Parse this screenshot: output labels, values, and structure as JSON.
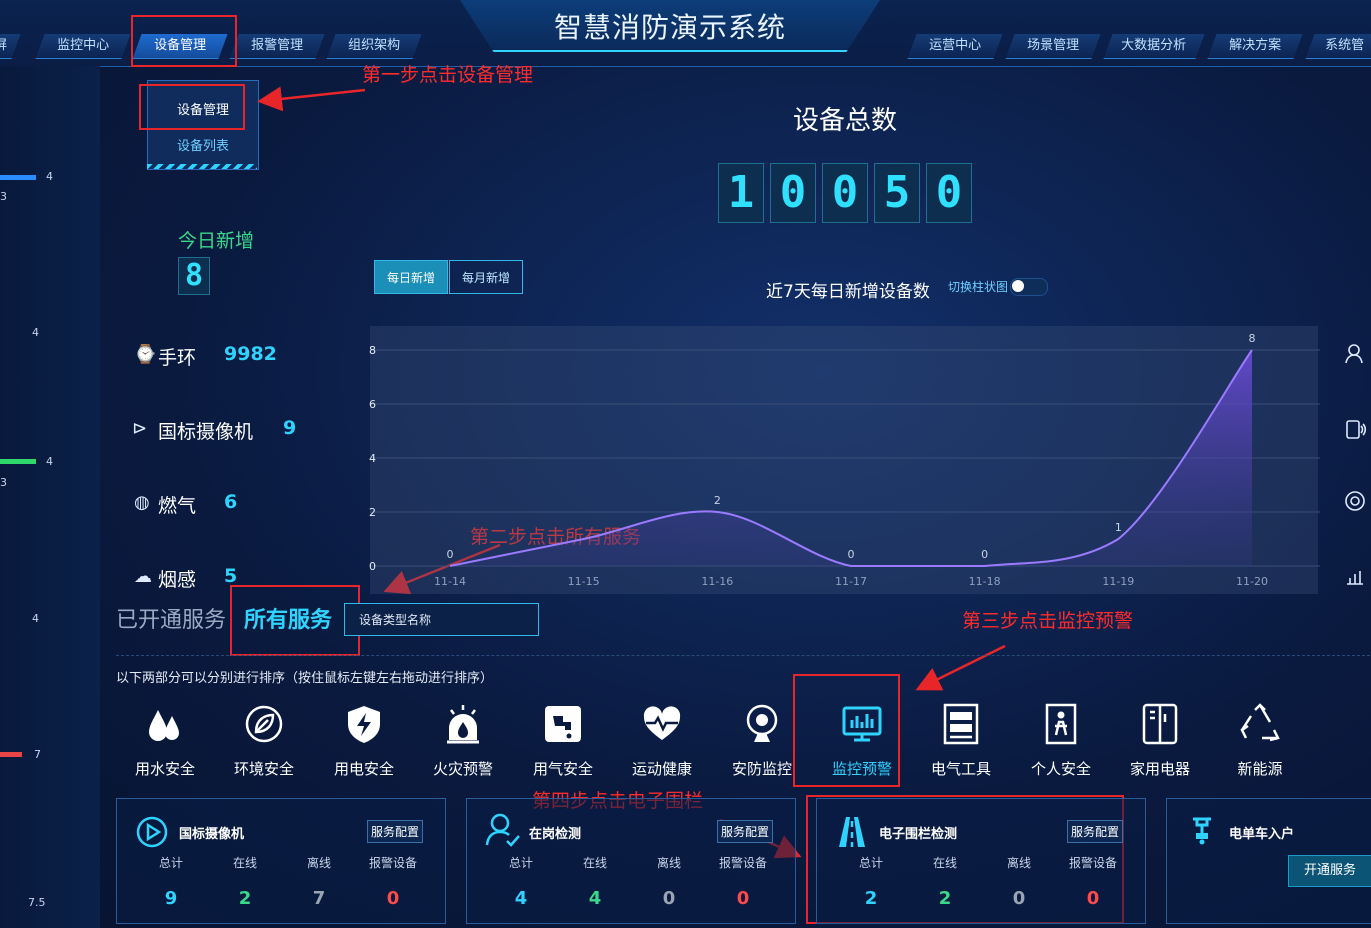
{
  "header": {
    "title": "智慧消防演示系统",
    "left_nav": [
      "屏",
      "监控中心",
      "设备管理",
      "报警管理",
      "组织架构"
    ],
    "right_nav": [
      "运营中心",
      "场景管理",
      "大数据分析",
      "解决方案",
      "系统管"
    ]
  },
  "left_strip": {
    "values": [
      "4",
      "3",
      "4",
      "4",
      "3",
      "4",
      "7",
      "7.5"
    ]
  },
  "dropdown": {
    "items": [
      "设备管理",
      "设备列表"
    ]
  },
  "annotations": {
    "step1": "第一步点击设备管理",
    "step2": "第二步点击所有服务",
    "step3": "第三步点击监控预警",
    "step4": "第四步点击电子围栏"
  },
  "total": {
    "label": "设备总数",
    "digits": [
      "1",
      "0",
      "0",
      "5",
      "0"
    ]
  },
  "today": {
    "label": "今日新增",
    "value": "8"
  },
  "toggle": {
    "daily": "每日新增",
    "monthly": "每月新增"
  },
  "chart_header": {
    "title": "近7天每日新增设备数",
    "switch_label": "切换柱状图"
  },
  "devices": [
    {
      "icon": "bracelet-icon",
      "name": "手环",
      "value": "9982"
    },
    {
      "icon": "camera-icon",
      "name": "国标摄像机",
      "value": "9"
    },
    {
      "icon": "gas-icon",
      "name": "燃气",
      "value": "6"
    },
    {
      "icon": "smoke-icon",
      "name": "烟感",
      "value": "5"
    }
  ],
  "chart_data": {
    "type": "area",
    "categories": [
      "11-14",
      "11-15",
      "11-16",
      "11-17",
      "11-18",
      "11-19",
      "11-20"
    ],
    "series": [
      {
        "values": [
          0,
          1,
          2,
          0,
          0,
          1,
          8
        ]
      }
    ],
    "data_labels": [
      "0",
      "",
      "2",
      "0",
      "0",
      "1",
      "8"
    ],
    "yticks": [
      "0",
      "2",
      "4",
      "6",
      "8"
    ],
    "ylim": [
      0,
      8
    ],
    "grid": true
  },
  "services": {
    "open_label": "已开通服务",
    "all_label": "所有服务",
    "search_placeholder": "设备类型名称",
    "sort_hint": "以下两部分可以分别进行排序（按住鼠标左键左右拖动进行排序）",
    "items": [
      {
        "icon": "water-drop-icon",
        "label": "用水安全"
      },
      {
        "icon": "leaf-icon",
        "label": "环境安全"
      },
      {
        "icon": "lightning-shield-icon",
        "label": "用电安全"
      },
      {
        "icon": "fire-alarm-icon",
        "label": "火灾预警"
      },
      {
        "icon": "gas-tap-icon",
        "label": "用气安全"
      },
      {
        "icon": "heart-rate-icon",
        "label": "运动健康"
      },
      {
        "icon": "webcam-icon",
        "label": "安防监控"
      },
      {
        "icon": "monitor-chart-icon",
        "label": "监控预警"
      },
      {
        "icon": "electric-box-icon",
        "label": "电气工具"
      },
      {
        "icon": "person-gate-icon",
        "label": "个人安全"
      },
      {
        "icon": "fridge-icon",
        "label": "家用电器"
      },
      {
        "icon": "recycle-icon",
        "label": "新能源"
      }
    ]
  },
  "cards": {
    "headers": [
      "总计",
      "在线",
      "离线",
      "报警设备"
    ],
    "config_label": "服务配置",
    "open_label": "开通服务",
    "items": [
      {
        "title": "国标摄像机",
        "values": [
          "9",
          "2",
          "7",
          "0"
        ]
      },
      {
        "title": "在岗检测",
        "values": [
          "4",
          "4",
          "0",
          "0"
        ]
      },
      {
        "title": "电子围栏检测",
        "values": [
          "2",
          "2",
          "0",
          "0"
        ]
      },
      {
        "title": "电单车入户"
      }
    ]
  },
  "colors": {
    "accent": "#2fd3ff",
    "green": "#39d98a",
    "red": "#e8262a",
    "chart_line": "#9a7bff"
  }
}
